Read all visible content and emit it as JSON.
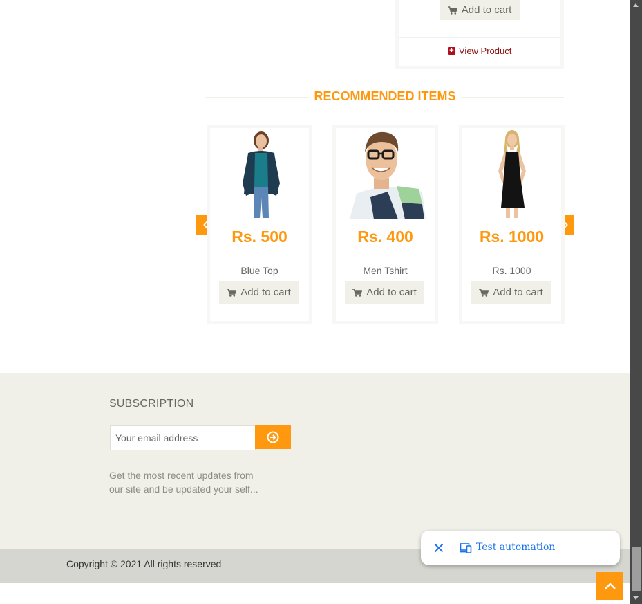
{
  "top_card": {
    "cart_label": "Add to cart",
    "view_product_label": "View Product"
  },
  "recommended": {
    "title": "RECOMMENDED ITEMS",
    "items": [
      {
        "price": "Rs. 500",
        "name": "Blue Top",
        "cart_label": "Add to cart"
      },
      {
        "price": "Rs. 400",
        "name": "Men Tshirt",
        "cart_label": "Add to cart"
      },
      {
        "price": "Rs. 1000",
        "name": "Rs. 1000",
        "cart_label": "Add to cart"
      }
    ]
  },
  "footer": {
    "subscription_title": "SUBSCRIPTION",
    "email_placeholder": "Your email address",
    "description": "Get the most recent updates from our site and be updated your self...",
    "copyright": "Copyright © 2021 All rights reserved"
  },
  "toast": {
    "label": "Test automation"
  },
  "colors": {
    "accent": "#fe980f",
    "footer_bg": "#f0f0e9",
    "footer_bottom_bg": "#d6d6d0",
    "link_blue": "#1a73e8"
  },
  "icons": [
    "shopping-cart-icon",
    "plus-square-icon",
    "chevron-left-icon",
    "chevron-right-icon",
    "arrow-circle-right-icon",
    "close-icon",
    "devices-icon",
    "chevron-up-icon"
  ]
}
